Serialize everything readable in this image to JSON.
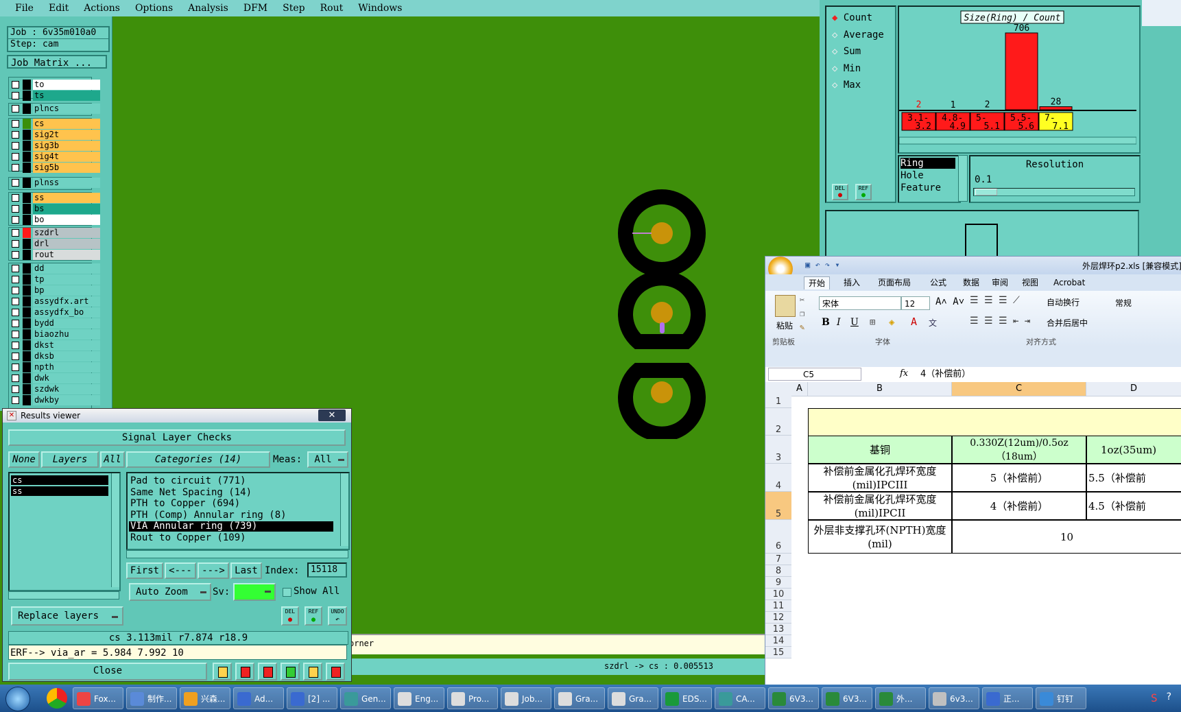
{
  "menu": [
    "File",
    "Edit",
    "Actions",
    "Options",
    "Analysis",
    "DFM",
    "Step",
    "Rout",
    "Windows"
  ],
  "job": {
    "job_label": "Job : 6v35m010a0",
    "step_label": "Step: cam",
    "matrix_button": "Job Matrix ..."
  },
  "layers_group1": [
    {
      "name": "to",
      "color": "#ffffff"
    },
    {
      "name": "ts",
      "color": "#1ea88c"
    }
  ],
  "layers_group2": [
    {
      "name": "plncs",
      "color": "#6fd2c3"
    }
  ],
  "layers_group3": [
    {
      "name": "cs",
      "color": "#ffc34d",
      "swatch": "#3a8f0a"
    },
    {
      "name": "sig2t",
      "color": "#ffc34d"
    },
    {
      "name": "sig3b",
      "color": "#ffc34d"
    },
    {
      "name": "sig4t",
      "color": "#ffc34d"
    },
    {
      "name": "sig5b",
      "color": "#ffc34d"
    }
  ],
  "layers_group4": [
    {
      "name": "plnss",
      "color": "#6fd2c3"
    }
  ],
  "layers_group5": [
    {
      "name": "ss",
      "color": "#ffc34d"
    },
    {
      "name": "bs",
      "color": "#1ea88c"
    },
    {
      "name": "bo",
      "color": "#ffffff"
    }
  ],
  "layers_group6": [
    {
      "name": "szdrl",
      "color": "#b7c3c6",
      "swatch": "#ff1a1a"
    },
    {
      "name": "drl",
      "color": "#b7c3c6"
    },
    {
      "name": "rout",
      "color": "#d8dcdc"
    }
  ],
  "layers_group7": [
    {
      "name": "dd",
      "color": "#6fd2c3"
    },
    {
      "name": "tp",
      "color": "#6fd2c3"
    },
    {
      "name": "bp",
      "color": "#6fd2c3"
    },
    {
      "name": "assydfx.art",
      "color": "#6fd2c3"
    },
    {
      "name": "assydfx_bo",
      "color": "#6fd2c3"
    },
    {
      "name": "bydd",
      "color": "#6fd2c3"
    },
    {
      "name": "biaozhu",
      "color": "#6fd2c3"
    },
    {
      "name": "dkst",
      "color": "#6fd2c3"
    },
    {
      "name": "dksb",
      "color": "#6fd2c3"
    },
    {
      "name": "npth",
      "color": "#6fd2c3"
    },
    {
      "name": "dwk",
      "color": "#6fd2c3"
    },
    {
      "name": "szdwk",
      "color": "#6fd2c3"
    },
    {
      "name": "dwkby",
      "color": "#6fd2c3"
    }
  ],
  "results_viewer": {
    "title": "Results viewer",
    "header": "Signal Layer Checks",
    "btn_none": "None",
    "btn_layers": "Layers",
    "btn_all": "All",
    "categories_label": "Categories (14)",
    "meas_label": "Meas:",
    "meas_value": "All",
    "layers": [
      "cs",
      "ss"
    ],
    "categories": [
      "Pad to circuit (771)",
      "Same Net Spacing (14)",
      "PTH to Copper (694)",
      "PTH (Comp) Annular ring (8)",
      "VIA Annular ring (739)",
      "Rout to Copper (109)"
    ],
    "selected_category": "VIA Annular ring (739)",
    "nav_first": "First",
    "nav_prev": "<---",
    "nav_next": "--->",
    "nav_last": "Last",
    "index_label": "Index:",
    "index_value": "15118",
    "auto_zoom": "Auto Zoom",
    "sv_label": "Sv:",
    "show_all": "Show All",
    "replace_layers": "Replace layers",
    "measure_line": "cs 3.113mil  r7.874  r18.9",
    "erf_line": "ERF--> via_ar = 5.984 7.992 10",
    "close": "Close",
    "del": "DEL",
    "ref": "REF",
    "undo": "UNDO"
  },
  "canvas_status": {
    "left": "orner",
    "bottom": "szdrl -> cs : 0.005513"
  },
  "histogram": {
    "options": [
      "Count",
      "Average",
      "Sum",
      "Min",
      "Max"
    ],
    "selected": "Count",
    "title": "Size(Ring) / Count",
    "del": "DEL",
    "ref": "REF",
    "type_list": [
      "Ring",
      "Hole",
      "Feature"
    ],
    "type_selected": "Ring",
    "resolution_label": "Resolution",
    "resolution_value": "0.1"
  },
  "chart_data": {
    "type": "bar",
    "title": "Size(Ring) / Count",
    "categories": [
      "3.1-3.2",
      "4.8-4.9",
      "5-5.1",
      "5.5-5.6",
      "7-7.1"
    ],
    "values": [
      2,
      1,
      2,
      706,
      28
    ],
    "value_label_colors": [
      "#ff0000",
      "#000000",
      "#000000",
      "#000000",
      "#000000"
    ],
    "bar_color": "#ff1a1a",
    "category_colors": [
      "#ff1a1a",
      "#ff1a1a",
      "#ff1a1a",
      "#ff1a1a",
      "#ffff22"
    ]
  },
  "excel": {
    "title": "外层焊环p2.xls [兼容模式]",
    "tabs": [
      "开始",
      "插入",
      "页面布局",
      "公式",
      "数据",
      "审阅",
      "视图",
      "Acrobat"
    ],
    "font_name": "宋体",
    "font_size": "12",
    "number_format": "常规",
    "ribbon_labels": {
      "paste": "粘贴",
      "clipboard": "剪贴板",
      "font": "字体",
      "align": "对齐方式",
      "wrap": "自动换行",
      "merge": "合并后居中"
    },
    "name_box": "C5",
    "formula": "4（补偿前）",
    "fx": "fx",
    "columns": [
      "A",
      "B",
      "C",
      "D"
    ],
    "rows": [
      "1",
      "2",
      "3",
      "4",
      "5",
      "6",
      "7",
      "8",
      "9",
      "10",
      "11",
      "12",
      "13",
      "14",
      "15"
    ],
    "cells": {
      "b3": "基铜",
      "c3": "0.330Z(12um)/0.5oz（18um）",
      "d3": "1oz(35um)",
      "b4": "补偿前金属化孔焊环宽度(mil)IPCIII",
      "c4": "5（补偿前）",
      "d4": "5.5（补偿前",
      "b5": "补偿前金属化孔焊环宽度(mil)IPCII",
      "c5": "4（补偿前）",
      "d5": "4.5（补偿前",
      "b6": "外层非支撑孔环(NPTH)宽度(mil)",
      "c6": "10"
    }
  },
  "taskbar": [
    "Fox...",
    "制作...",
    "兴森...",
    "Ad...",
    "[2] ...",
    "Gen...",
    "Eng...",
    "Pro...",
    "Job...",
    "Gra...",
    "Gra...",
    "EDS...",
    "CA...",
    "6V3...",
    "6V3...",
    "外...",
    "6v3...",
    "正...",
    "钉钉"
  ]
}
